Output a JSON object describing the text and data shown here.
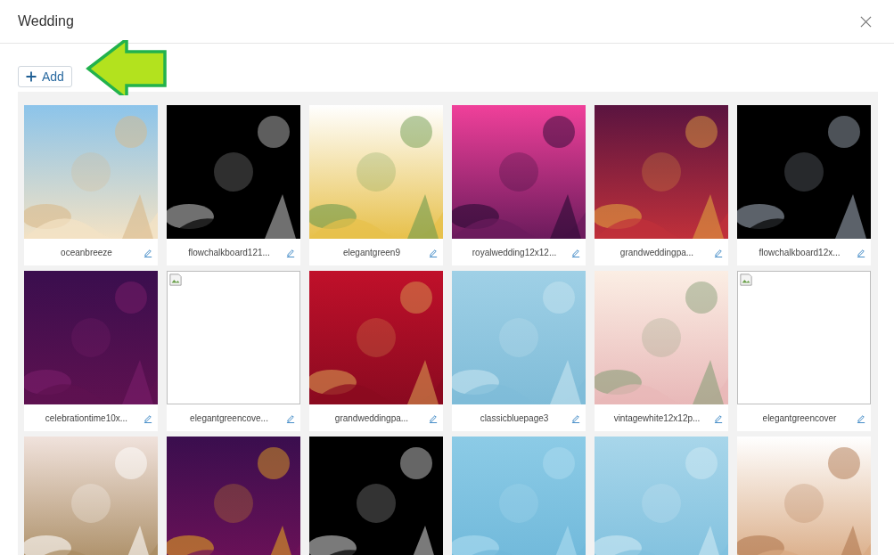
{
  "dialog": {
    "title": "Wedding"
  },
  "add_button": {
    "label": "Add"
  },
  "tiles": [
    {
      "kind": "picture",
      "caption": "oceanbreeze"
    },
    {
      "kind": "picture",
      "caption": "flowchalkboard121..."
    },
    {
      "kind": "picture",
      "caption": "elegantgreen9"
    },
    {
      "kind": "picture",
      "caption": "royalwedding12x12..."
    },
    {
      "kind": "picture",
      "caption": "grandweddingpa..."
    },
    {
      "kind": "picture",
      "caption": "flowchalkboard12x..."
    },
    {
      "kind": "picture",
      "caption": "celebrationtime10x..."
    },
    {
      "kind": "broken",
      "caption": "elegantgreencove..."
    },
    {
      "kind": "picture",
      "caption": "grandweddingpa..."
    },
    {
      "kind": "picture",
      "caption": "classicbluepage3"
    },
    {
      "kind": "picture",
      "caption": "vintagewhite12x12p..."
    },
    {
      "kind": "broken",
      "caption": "elegantgreencover"
    },
    {
      "kind": "picture"
    },
    {
      "kind": "picture"
    },
    {
      "kind": "picture"
    },
    {
      "kind": "picture"
    },
    {
      "kind": "picture"
    },
    {
      "kind": "picture"
    }
  ]
}
